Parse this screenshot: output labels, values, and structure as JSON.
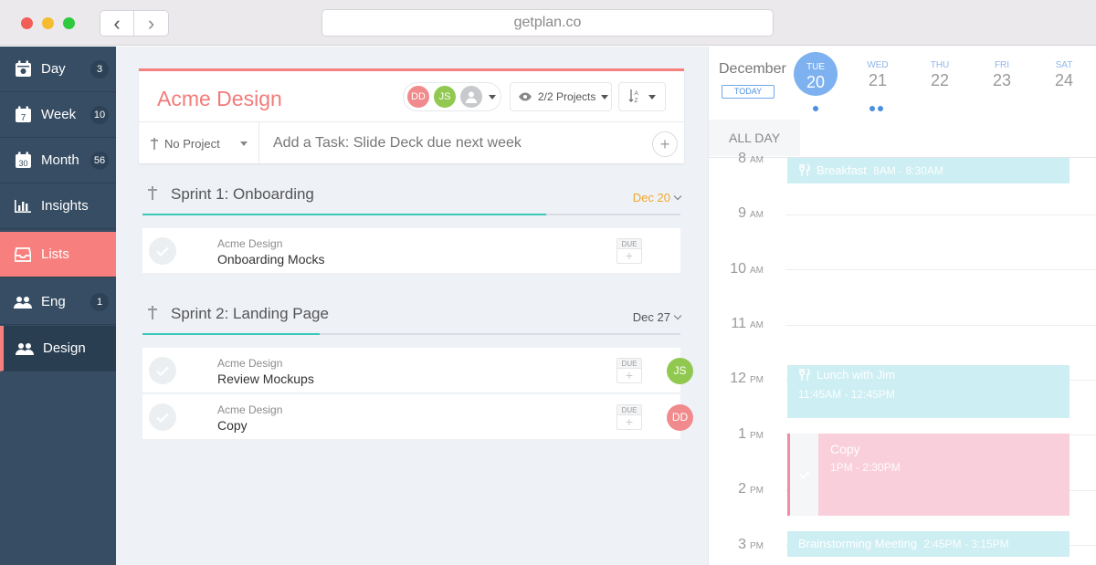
{
  "browser": {
    "url": "getplan.co",
    "back_label": "‹",
    "forward_label": "›"
  },
  "sidebar": {
    "items": [
      {
        "label": "Day",
        "badge": "3",
        "icon": "calendar-day-icon"
      },
      {
        "label": "Week",
        "badge": "10",
        "icon": "calendar-week-icon"
      },
      {
        "label": "Month",
        "badge": "56",
        "icon": "calendar-month-icon"
      },
      {
        "label": "Insights",
        "badge": "",
        "icon": "chart-icon"
      },
      {
        "label": "Lists",
        "badge": "",
        "icon": "inbox-icon"
      },
      {
        "label": "Eng",
        "badge": "1",
        "icon": "team-icon"
      },
      {
        "label": "Design",
        "badge": "",
        "icon": "team-icon"
      }
    ],
    "calendar_icon_numbers": {
      "week": "7",
      "month": "30"
    }
  },
  "project": {
    "title": "Acme Design",
    "members": [
      "DD",
      "JS"
    ],
    "projects_filter": "2/2 Projects",
    "sort_icon_label": "A Z",
    "no_project": "No Project",
    "add_task_placeholder": "Add a Task: Slide Deck due next week",
    "add_button": "+"
  },
  "sprints": [
    {
      "title": "Sprint 1: Onboarding",
      "date": "Dec 20",
      "date_color": "#f0a830",
      "progress": 0.75,
      "tasks": [
        {
          "project": "Acme Design",
          "name": "Onboarding Mocks",
          "due": "DUE",
          "assignee": ""
        }
      ]
    },
    {
      "title": "Sprint 2: Landing Page",
      "date": "Dec 27",
      "date_color": "#555555",
      "progress": 0.33,
      "tasks": [
        {
          "project": "Acme Design",
          "name": "Review Mockups",
          "due": "DUE",
          "assignee": "JS"
        },
        {
          "project": "Acme Design",
          "name": "Copy",
          "due": "DUE",
          "assignee": "DD"
        }
      ]
    }
  ],
  "calendar": {
    "month": "December",
    "today_label": "TODAY",
    "all_day_label": "ALL DAY",
    "days": [
      {
        "name": "TUE",
        "num": "20",
        "dots": 1
      },
      {
        "name": "WED",
        "num": "21",
        "dots": 2
      },
      {
        "name": "THU",
        "num": "22",
        "dots": 0
      },
      {
        "name": "FRI",
        "num": "23",
        "dots": 0
      },
      {
        "name": "SAT",
        "num": "24",
        "dots": 0
      }
    ],
    "hours": [
      {
        "num": "8",
        "ampm": "AM"
      },
      {
        "num": "9",
        "ampm": "AM"
      },
      {
        "num": "10",
        "ampm": "AM"
      },
      {
        "num": "11",
        "ampm": "AM"
      },
      {
        "num": "12",
        "ampm": "PM"
      },
      {
        "num": "1",
        "ampm": "PM"
      },
      {
        "num": "2",
        "ampm": "PM"
      },
      {
        "num": "3",
        "ampm": "PM"
      }
    ],
    "events": [
      {
        "title": "Breakfast",
        "time": "8AM - 8:30AM"
      },
      {
        "title": "Lunch with Jim",
        "time": "11:45AM - 12:45PM"
      },
      {
        "title": "Copy",
        "time": "1PM - 2:30PM"
      },
      {
        "title": "Brainstorming Meeting",
        "time": "2:45PM - 3:15PM"
      }
    ]
  },
  "colors": {
    "accent": "#f7807f",
    "sidebar": "#364d63",
    "teal": "#3bc8b8",
    "calendar_blue": "#7db1f0",
    "event_cyan": "#cdeef2",
    "event_pink": "#f9cfdb",
    "avatar_dd": "#f08a8c",
    "avatar_js": "#90c850"
  }
}
